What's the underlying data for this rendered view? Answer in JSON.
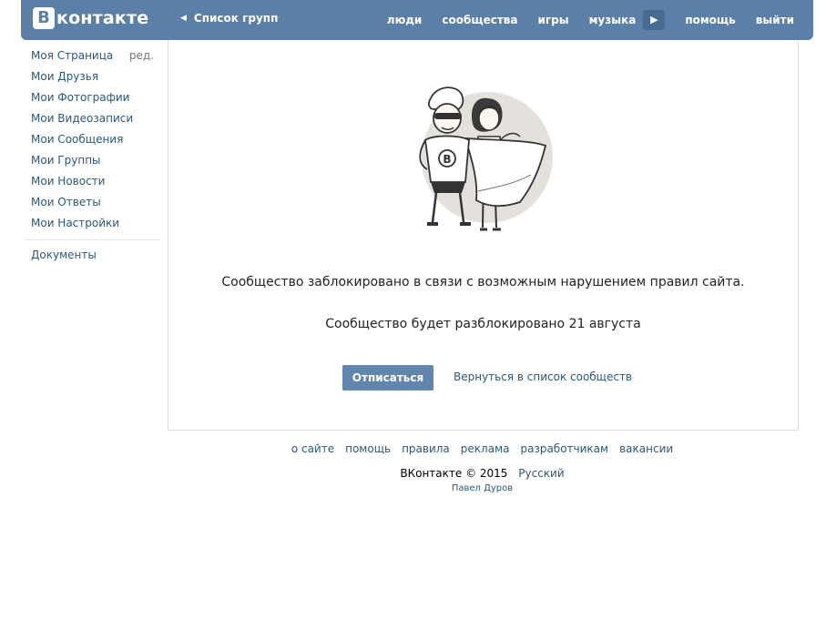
{
  "header": {
    "logo_letter": "B",
    "logo_text": "контакте",
    "back_label": "Список групп",
    "nav": [
      "люди",
      "сообщества",
      "игры",
      "музыка",
      "помощь",
      "выйти"
    ]
  },
  "sidebar": {
    "items": [
      {
        "label": "Моя Страница",
        "edit": "ред."
      },
      {
        "label": "Мои Друзья"
      },
      {
        "label": "Мои Фотографии"
      },
      {
        "label": "Мои Видеозаписи"
      },
      {
        "label": "Мои Сообщения"
      },
      {
        "label": "Мои Группы"
      },
      {
        "label": "Мои Новости"
      },
      {
        "label": "Мои Ответы"
      },
      {
        "label": "Мои Настройки"
      }
    ],
    "extra": "Документы"
  },
  "main": {
    "message_blocked": "Сообщество заблокировано в связи с возможным нарушением правил сайта.",
    "message_unblock": "Сообщество будет разблокировано 21 августа",
    "unsubscribe_label": "Отписаться",
    "back_to_groups_label": "Вернуться в список сообществ",
    "hero_badge": "B"
  },
  "footer": {
    "links": [
      "о сайте",
      "помощь",
      "правила",
      "реклама",
      "разработчикам",
      "вакансии"
    ],
    "copyright": "ВКонтакте © 2015",
    "language": "Русский",
    "author": "Павел Дуров"
  },
  "colors": {
    "header_bg": "#5b7fa6",
    "link": "#2b587a",
    "button_bg": "#6285ad"
  }
}
